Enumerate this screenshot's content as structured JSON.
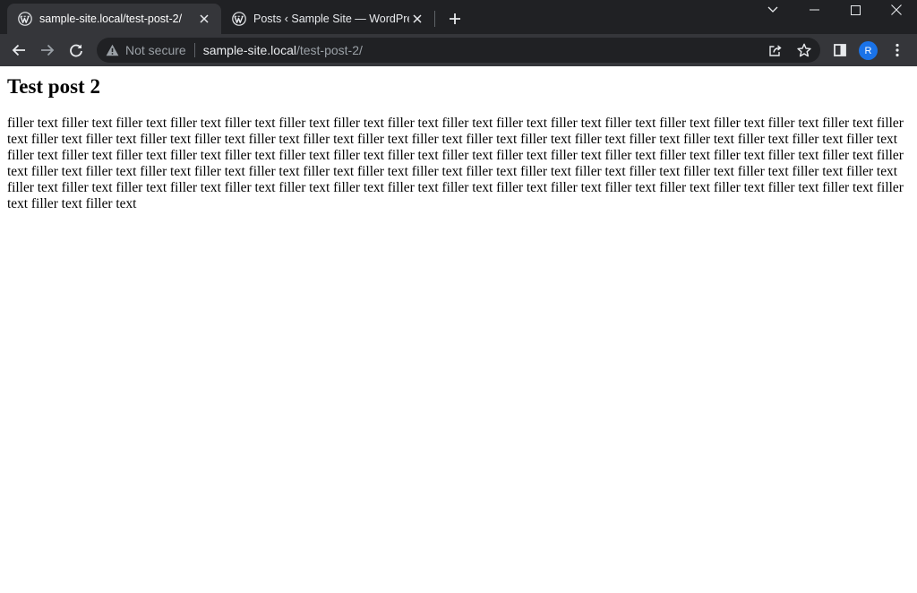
{
  "tabs": [
    {
      "title": "sample-site.local/test-post-2/",
      "active": true,
      "favicon": "wordpress-icon"
    },
    {
      "title": "Posts ‹ Sample Site — WordPress",
      "active": false,
      "favicon": "wordpress-icon"
    }
  ],
  "toolbar": {
    "security_label": "Not secure",
    "url_host": "sample-site.local",
    "url_path": "/test-post-2/"
  },
  "profile": {
    "initial": "R",
    "color": "#1a73e8"
  },
  "colors": {
    "tabstrip": "#202124",
    "toolbar": "#35363a",
    "omnibox": "#202124"
  },
  "page": {
    "title": "Test post 2",
    "body": "filler text filler text filler text filler text filler text filler text filler text filler text filler text filler text filler text filler text filler text filler text filler text filler text filler text filler text filler text filler text filler text filler text filler text filler text filler text filler text filler text filler text filler text filler text filler text filler text filler text filler text filler text filler text filler text filler text filler text filler text filler text filler text filler text filler text filler text filler text filler text filler text filler text filler text filler text filler text filler text filler text filler text filler text filler text filler text filler text filler text filler text filler text filler text filler text filler text filler text filler text filler text filler text filler text filler text filler text filler text filler text filler text filler text filler text filler text filler text filler text filler text filler text filler text filler text filler text"
  }
}
